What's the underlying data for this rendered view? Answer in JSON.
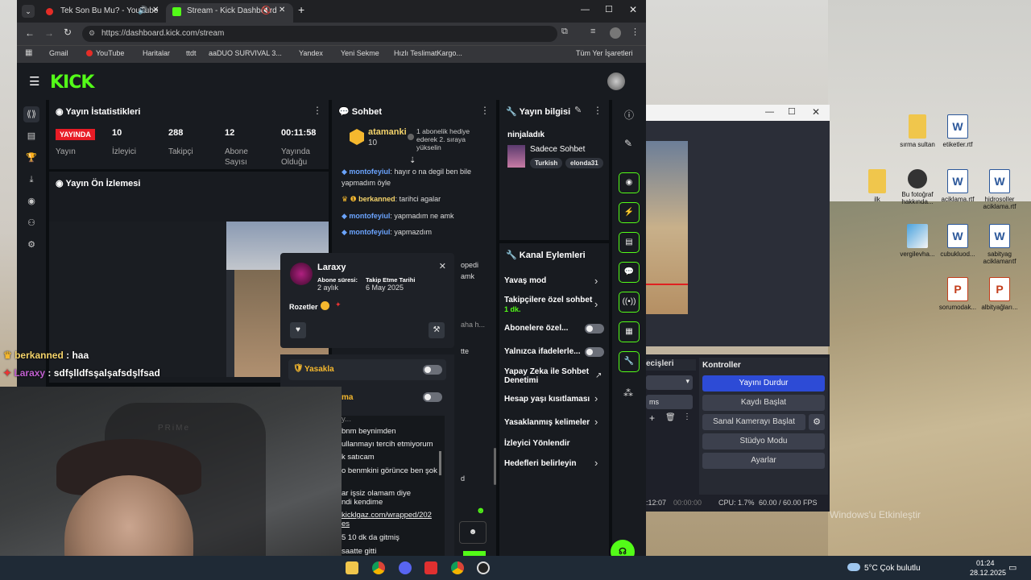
{
  "browser": {
    "tabs": [
      {
        "label": "Tek Son Bu Mu? - YouTube"
      },
      {
        "label": "Stream - Kick Dashboard"
      }
    ],
    "url": "https://dashboard.kick.com/stream",
    "bookmarks": [
      "Gmail",
      "YouTube",
      "Haritalar",
      "ttdt",
      "aaDUO SURVIVAL 3...",
      "Yandex",
      "Yeni Sekme",
      "Hızlı TeslimatKargo..."
    ],
    "all_bookmarks": "Tüm Yer İşaretleri"
  },
  "kick": {
    "logo": "KICK",
    "stats": {
      "title": "Yayın İstatistikleri",
      "live_badge": "YAYINDA",
      "items": [
        {
          "label": "Yayın",
          "value": ""
        },
        {
          "label": "İzleyici",
          "value": "10"
        },
        {
          "label": "Takipçi",
          "value": "288"
        },
        {
          "label": "Abone Sayısı",
          "value": "12"
        },
        {
          "label": "Yayında Olduğu",
          "value": "00:11:58"
        }
      ]
    },
    "preview_title": "Yayın Ön İzlemesi",
    "chat": {
      "title": "Sohbet",
      "pinned_user": "atamanki",
      "pinned_count": "10",
      "pinned_note": "1 abonelik hediye ederek 2. sıraya yükselin",
      "messages": [
        {
          "user": "montofeyiul",
          "text": ": hayır o na degil ben bile yapmadım öyle"
        },
        {
          "user": "berkanned",
          "text": ": tarihci agalar"
        },
        {
          "user": "montofeyiul",
          "text": ": yapmadım ne amk"
        },
        {
          "user": "montofeyiul",
          "text": ": yapmazdım"
        }
      ],
      "fragments": [
        "opedi",
        "amk",
        "aha h...",
        "tte",
        "d"
      ]
    },
    "info": {
      "title": "Yayın bilgisi",
      "username": "ninjaladık",
      "category": "Sadece Sohbet",
      "tags": [
        "Turkish",
        "elonda31"
      ]
    },
    "actions": {
      "title": "Kanal Eylemleri",
      "items": [
        {
          "label": "Yavaş mod"
        },
        {
          "label": "Takipçilere özel sohbet",
          "sub": "1 dk."
        },
        {
          "label": "Abonelere özel..."
        },
        {
          "label": "Yalnızca ifadelerle..."
        },
        {
          "label": "Yapay Zeka ile Sohbet Denetimi"
        },
        {
          "label": "Hesap yaşı kısıtlaması"
        },
        {
          "label": "Yasaklanmış kelimeler"
        },
        {
          "label": "İzleyici Yönlendir"
        },
        {
          "label": "Hedefleri belirleyin"
        }
      ]
    },
    "user_card": {
      "name": "Laraxy",
      "sub_label": "Abone süresi:",
      "sub_value": "2 aylık",
      "follow_label": "Takip Etme Tarihi",
      "follow_value": "6 May 2025",
      "badges": "Rozetler",
      "ban": "Yasakla",
      "timeout": "ma"
    }
  },
  "overlay_chat": [
    {
      "user": "berkanned",
      "text": " : haa"
    },
    {
      "user": "Laraxy",
      "text": " : sdfşlldfsşalşafsdşlfsad"
    }
  ],
  "popup_chat": [
    "y...",
    "bnm beynimden",
    "ullanmayı tercih etmiyorum",
    "k satıcam",
    "o benmkini görünce ben şok",
    "ar işsiz olamam diye",
    "ndi kendime",
    "kicklgaz.com/wrapped/202",
    "es",
    "5 10 dk da gitmiş",
    "saatte gitti"
  ],
  "obs": {
    "controls_title": "Kontroller",
    "transitions_title": "ecişleri",
    "buttons": [
      "Yayını Durdur",
      "Kaydı Başlat",
      "Sanal Kamerayı Başlat",
      "Stüdyo Modu",
      "Ayarlar"
    ],
    "ms": "ms",
    "status": {
      "time": ":12:07",
      "rec": "00:00:00",
      "cpu": "CPU: 1.7%",
      "fps": "60.00 / 60.00 FPS"
    }
  },
  "desktop": {
    "icons": [
      {
        "label": "sırma sultan",
        "type": "fold"
      },
      {
        "label": "etiketler.rtf",
        "type": "word"
      },
      {
        "label": "ilk",
        "type": "fold"
      },
      {
        "label": "Bu fotoğraf hakkında...",
        "type": "circ"
      },
      {
        "label": "aciklama.rtf",
        "type": "word"
      },
      {
        "label": "hidrosoller aciklama.rtf",
        "type": "word"
      },
      {
        "label": "vergilevha...",
        "type": "img"
      },
      {
        "label": "cubukluod...",
        "type": "word"
      },
      {
        "label": "sabityag aciklamarıtf",
        "type": "word"
      },
      {
        "label": "sorumodak...",
        "type": "ppt"
      },
      {
        "label": "albityağları...",
        "type": "ppt"
      }
    ],
    "watermark": "Windows'u Etkinleştir"
  },
  "taskbar": {
    "weather": "5°C  Çok bulutlu",
    "time": "01:24",
    "date": "28.12.2025"
  }
}
